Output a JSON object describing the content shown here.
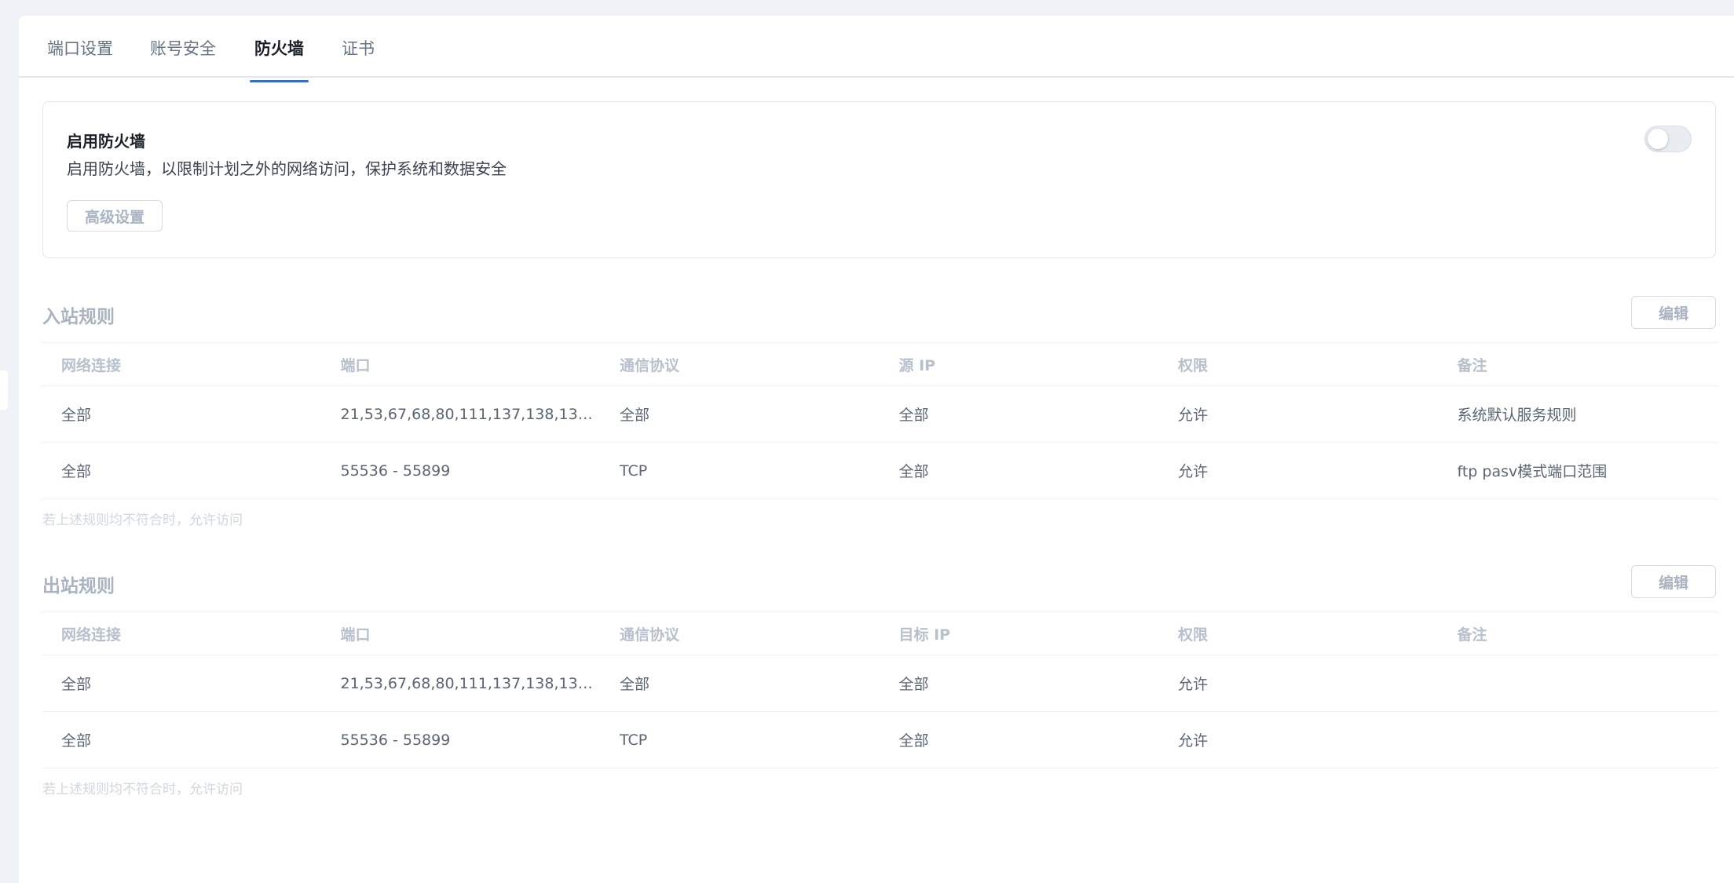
{
  "tabs": [
    {
      "label": "端口设置",
      "active": false
    },
    {
      "label": "账号安全",
      "active": false
    },
    {
      "label": "防火墙",
      "active": true
    },
    {
      "label": "证书",
      "active": false
    }
  ],
  "firewall": {
    "title": "启用防火墙",
    "description": "启用防火墙，以限制计划之外的网络访问，保护系统和数据安全",
    "advanced_button": "高级设置",
    "enabled": false
  },
  "inbound": {
    "title": "入站规则",
    "edit_label": "编辑",
    "columns": [
      "网络连接",
      "端口",
      "通信协议",
      "源 IP",
      "权限",
      "备注"
    ],
    "rows": [
      [
        "全部",
        "21,53,67,68,80,111,137,138,139,...",
        "全部",
        "全部",
        "允许",
        "系统默认服务规则"
      ],
      [
        "全部",
        "55536 - 55899",
        "TCP",
        "全部",
        "允许",
        "ftp pasv模式端口范围"
      ]
    ],
    "footnote": "若上述规则均不符合时，允许访问"
  },
  "outbound": {
    "title": "出站规则",
    "edit_label": "编辑",
    "columns": [
      "网络连接",
      "端口",
      "通信协议",
      "目标 IP",
      "权限",
      "备注"
    ],
    "rows": [
      [
        "全部",
        "21,53,67,68,80,111,137,138,139,...",
        "全部",
        "全部",
        "允许",
        ""
      ],
      [
        "全部",
        "55536 - 55899",
        "TCP",
        "全部",
        "允许",
        ""
      ]
    ],
    "footnote": "若上述规则均不符合时，允许访问"
  }
}
